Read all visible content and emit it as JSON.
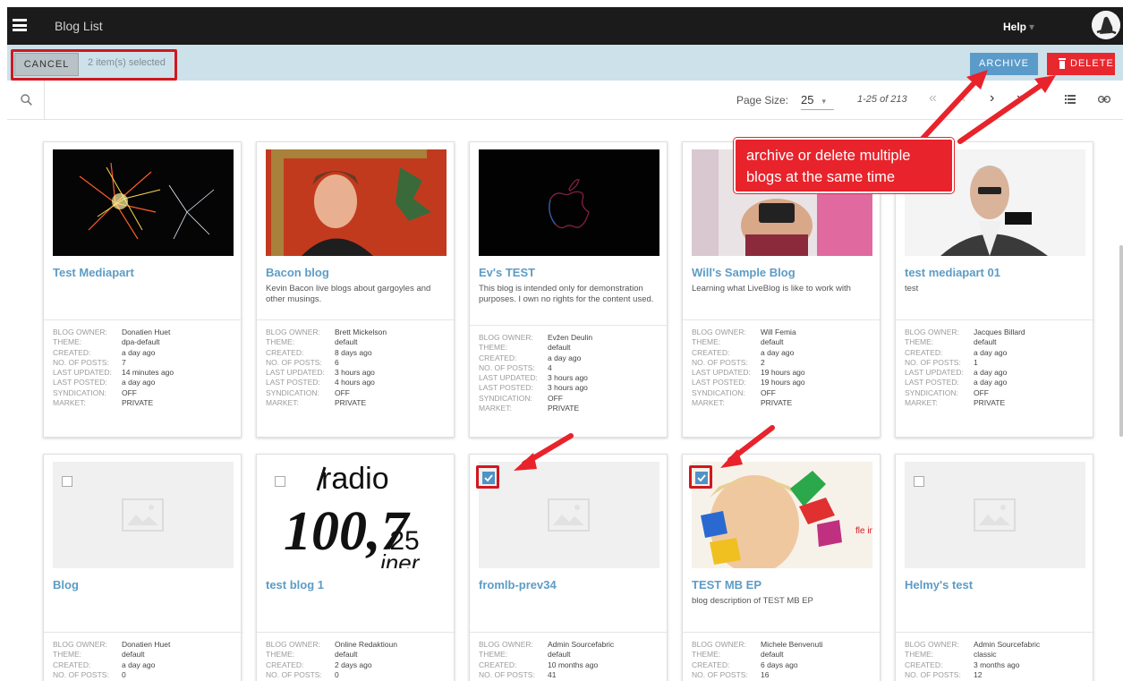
{
  "header": {
    "title": "Blog List",
    "help": "Help",
    "help_caret": "▾"
  },
  "selection": {
    "cancel_label": "CANCEL",
    "count_text": "2 item(s) selected",
    "archive_label": "ARCHIVE",
    "delete_label": "DELETE"
  },
  "toolbar": {
    "page_size_label": "Page Size:",
    "page_size": "25",
    "page_info": "1-25 of 213",
    "first": "«",
    "prev": "‹",
    "next": "›",
    "last": "»"
  },
  "annotation": {
    "line1": "archive or delete multiple",
    "line2": "blogs at the same time"
  },
  "meta_labels": {
    "owner": "Blog owner:",
    "theme": "Theme:",
    "created": "Created:",
    "posts": "No. of posts:",
    "updated": "Last updated:",
    "posted": "Last posted:",
    "syndication": "Syndication:",
    "market": "Market:"
  },
  "cards": [
    {
      "title": "Test Mediapart",
      "description": "",
      "owner": "Donatien Huet",
      "theme": "dpa-default",
      "created": "a day ago",
      "posts": "7",
      "updated": "14 minutes ago",
      "posted": "a day ago",
      "syndication": "OFF",
      "market": "PRIVATE"
    },
    {
      "title": "Bacon blog",
      "description": "Kevin Bacon live blogs about gargoyles and other musings.",
      "owner": "Brett Mickelson",
      "theme": "default",
      "created": "8 days ago",
      "posts": "6",
      "updated": "3 hours ago",
      "posted": "4 hours ago",
      "syndication": "OFF",
      "market": "PRIVATE"
    },
    {
      "title": "Ev's TEST",
      "description": "This blog is intended only for demonstration purposes. I own no rights for the content used.",
      "owner": "Evžen Deulin",
      "theme": "default",
      "created": "a day ago",
      "posts": "4",
      "updated": "3 hours ago",
      "posted": "3 hours ago",
      "syndication": "OFF",
      "market": "PRIVATE"
    },
    {
      "title": "Will's Sample Blog",
      "description": "Learning what LiveBlog is like to work with",
      "owner": "Will Femia",
      "theme": "default",
      "created": "a day ago",
      "posts": "2",
      "updated": "19 hours ago",
      "posted": "19 hours ago",
      "syndication": "OFF",
      "market": "PRIVATE"
    },
    {
      "title": "test mediapart 01",
      "description": "test",
      "owner": "Jacques Billard",
      "theme": "default",
      "created": "a day ago",
      "posts": "1",
      "updated": "a day ago",
      "posted": "a day ago",
      "syndication": "OFF",
      "market": "PRIVATE"
    },
    {
      "title": "Blog",
      "description": "",
      "owner": "Donatien Huet",
      "theme": "default",
      "created": "a day ago",
      "posts": "0",
      "checked": false
    },
    {
      "title": "test blog 1",
      "description": "",
      "owner": "Online Redaktioun",
      "theme": "default",
      "created": "2 days ago",
      "posts": "0",
      "checked": false,
      "logo_line1": "radio",
      "logo_line2": "100,7",
      "logo_line3": ".25",
      "logo_line4": "iner"
    },
    {
      "title": "fromlb-prev34",
      "description": "",
      "owner": "Admin Sourcefabric",
      "theme": "default",
      "created": "10 months ago",
      "posts": "41",
      "checked": true
    },
    {
      "title": "TEST MB EP",
      "description": "blog description of TEST MB EP",
      "owner": "Michele Benvenuti",
      "theme": "default",
      "created": "6 days ago",
      "posts": "16",
      "checked": true,
      "img_text": "fle indi"
    },
    {
      "title": "Helmy's test",
      "description": "",
      "owner": "Admin Sourcefabric",
      "theme": "classic",
      "created": "3 months ago",
      "posts": "12",
      "checked": false
    }
  ],
  "colors": {
    "accent": "#5d9cc5",
    "archive": "#5b9bc9",
    "delete": "#e8282f",
    "annotation": "#e8232b",
    "selection_bar": "#cde1ea"
  }
}
